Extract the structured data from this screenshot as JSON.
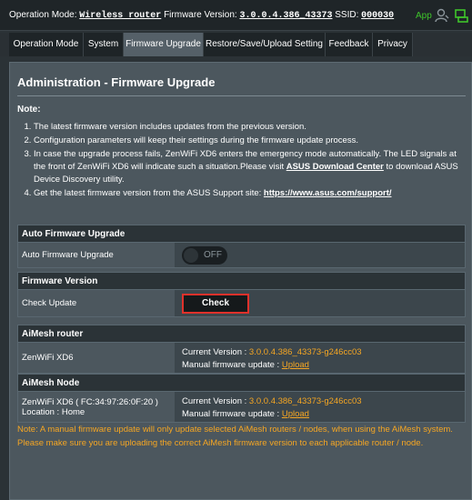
{
  "status": {
    "mode_label": "Operation Mode:",
    "mode_value": "Wireless router",
    "fw_label": "Firmware Version:",
    "fw_value": "3.0.0.4.386_43373",
    "ssid_label": "SSID:",
    "ssid_value": "000030",
    "app_label": "App"
  },
  "tabs": [
    "Operation Mode",
    "System",
    "Firmware Upgrade",
    "Restore/Save/Upload Setting",
    "Feedback",
    "Privacy"
  ],
  "page": {
    "title": "Administration - Firmware Upgrade",
    "note_heading": "Note:",
    "notes": {
      "n1": "The latest firmware version includes updates from the previous version.",
      "n2": "Configuration parameters will keep their settings during the firmware update process.",
      "n3_pre": "In case the upgrade process fails, ZenWiFi XD6 enters the emergency mode automatically. The LED signals at the front of ZenWiFi XD6 will indicate such a situation.Please visit ",
      "n3_link": "ASUS Download Center",
      "n3_post": " to download ASUS Device Discovery utility.",
      "n4_pre": "Get the latest firmware version from the ASUS Support site: ",
      "n4_link": "https://www.asus.com/support/"
    }
  },
  "auto_fw": {
    "heading": "Auto Firmware Upgrade",
    "label": "Auto Firmware Upgrade",
    "toggle_state": "OFF"
  },
  "fw_version": {
    "heading": "Firmware Version",
    "label": "Check Update",
    "button": "Check"
  },
  "aimesh_router": {
    "heading": "AiMesh router",
    "device": "ZenWiFi XD6",
    "current_label": "Current Version : ",
    "current_value": "3.0.0.4.386_43373-g246cc03",
    "manual_label": "Manual firmware update : ",
    "manual_link": "Upload"
  },
  "aimesh_node": {
    "heading": "AiMesh Node",
    "device": "ZenWiFi XD6 ( FC:34:97:26:0F:20 )",
    "location": "Location : Home",
    "current_label": "Current Version : ",
    "current_value": "3.0.0.4.386_43373-g246cc03",
    "manual_label": "Manual firmware update : ",
    "manual_link": "Upload"
  },
  "footer_note": "Note: A manual firmware update will only update selected AiMesh routers / nodes, when using the AiMesh system. Please make sure you are uploading the correct AiMesh firmware version to each applicable router / node.",
  "colors": {
    "accent": "#f5a623",
    "highlight": "#e0312b",
    "app_green": "#3ec52b"
  },
  "icons": [
    "user-icon",
    "usb-icon"
  ]
}
